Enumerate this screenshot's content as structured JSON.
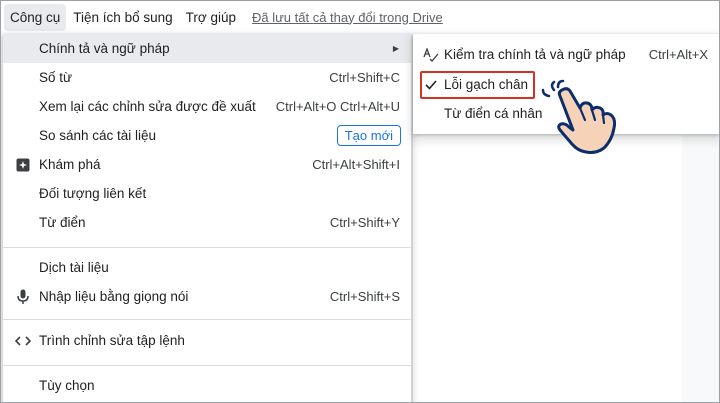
{
  "menubar": {
    "items": [
      "Công cụ",
      "Tiện ích bổ sung",
      "Trợ giúp"
    ],
    "save_status": "Đã lưu tất cả thay đổi trong Drive"
  },
  "tools_menu": {
    "items": [
      {
        "label": "Chính tả và ngữ pháp",
        "shortcut": "",
        "icon": "",
        "has_submenu": true
      },
      {
        "label": "Số từ",
        "shortcut": "Ctrl+Shift+C"
      },
      {
        "label": "Xem lại các chỉnh sửa được đề xuất",
        "shortcut": "Ctrl+Alt+O Ctrl+Alt+U"
      },
      {
        "label": "So sánh các tài liệu",
        "badge": "Tạo mới"
      },
      {
        "label": "Khám phá",
        "shortcut": "Ctrl+Alt+Shift+I",
        "icon": "explore-icon"
      },
      {
        "label": "Đối tượng liên kết",
        "shortcut": ""
      },
      {
        "label": "Từ điển",
        "shortcut": "Ctrl+Shift+Y"
      },
      {
        "label": "Dịch tài liệu",
        "shortcut": ""
      },
      {
        "label": "Nhập liệu bằng giọng nói",
        "shortcut": "Ctrl+Shift+S",
        "icon": "microphone-icon"
      },
      {
        "label": "Trình chỉnh sửa tập lệnh",
        "shortcut": "",
        "icon": "code-icon"
      },
      {
        "label": "Tùy chọn",
        "shortcut": ""
      }
    ]
  },
  "spelling_submenu": {
    "items": [
      {
        "label": "Kiểm tra chính tả và ngữ pháp",
        "shortcut": "Ctrl+Alt+X",
        "icon": "spellcheck-icon"
      },
      {
        "label": "Lỗi gạch chân",
        "checked": true,
        "icon": "checkmark-icon"
      },
      {
        "label": "Từ điển cá nhân"
      }
    ]
  },
  "colors": {
    "accent": "#1a73e8",
    "highlight_box": "#d93025",
    "hand_fill": "#f6d3b8",
    "hand_outline": "#0b2d6b"
  }
}
